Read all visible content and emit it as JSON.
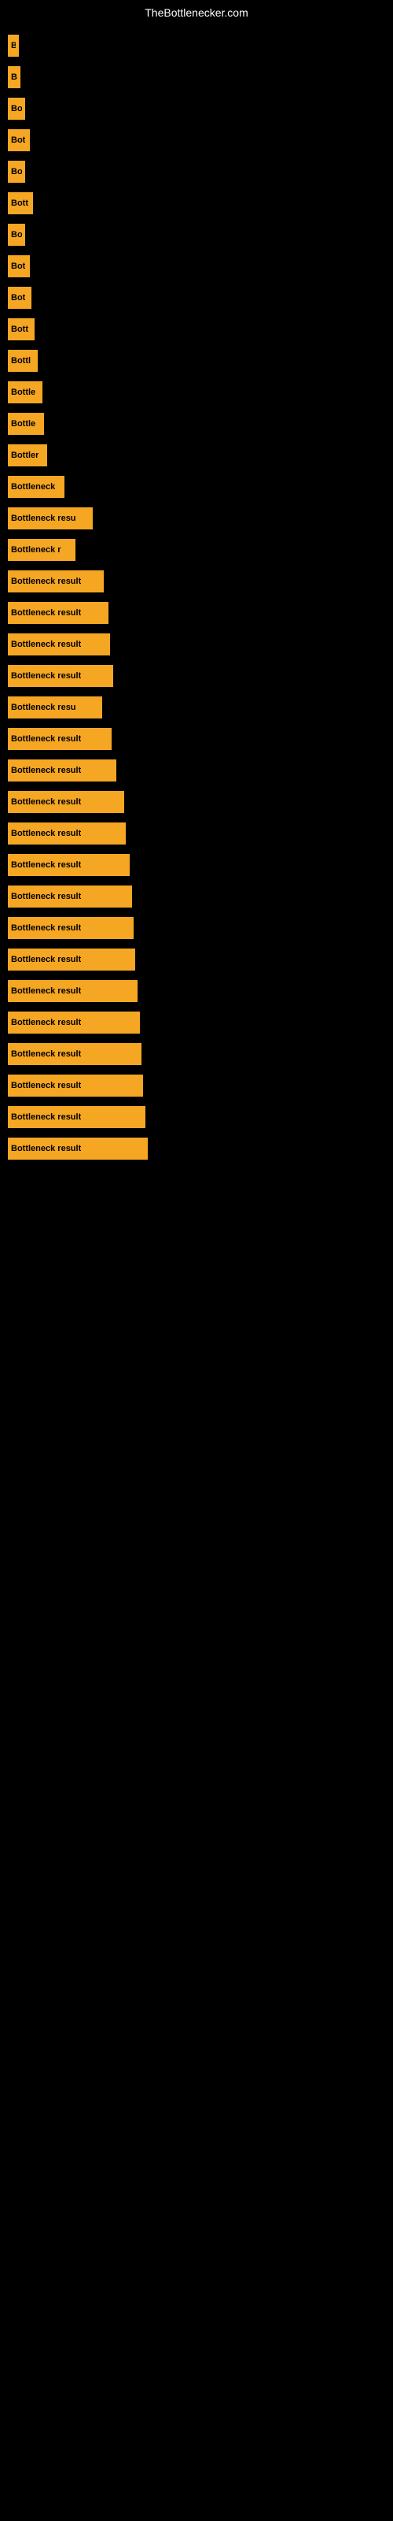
{
  "site": {
    "title": "TheBottlenecker.com"
  },
  "bars": [
    {
      "label": "B",
      "width": 14
    },
    {
      "label": "B",
      "width": 16
    },
    {
      "label": "Bo",
      "width": 22
    },
    {
      "label": "Bot",
      "width": 28
    },
    {
      "label": "Bo",
      "width": 22
    },
    {
      "label": "Bott",
      "width": 32
    },
    {
      "label": "Bo",
      "width": 22
    },
    {
      "label": "Bot",
      "width": 28
    },
    {
      "label": "Bot",
      "width": 30
    },
    {
      "label": "Bott",
      "width": 34
    },
    {
      "label": "Bottl",
      "width": 38
    },
    {
      "label": "Bottle",
      "width": 44
    },
    {
      "label": "Bottle",
      "width": 46
    },
    {
      "label": "Bottler",
      "width": 50
    },
    {
      "label": "Bottleneck",
      "width": 72
    },
    {
      "label": "Bottleneck resu",
      "width": 108
    },
    {
      "label": "Bottleneck r",
      "width": 86
    },
    {
      "label": "Bottleneck result",
      "width": 122
    },
    {
      "label": "Bottleneck result",
      "width": 128
    },
    {
      "label": "Bottleneck result",
      "width": 130
    },
    {
      "label": "Bottleneck result",
      "width": 134
    },
    {
      "label": "Bottleneck resu",
      "width": 120
    },
    {
      "label": "Bottleneck result",
      "width": 132
    },
    {
      "label": "Bottleneck result",
      "width": 138
    },
    {
      "label": "Bottleneck result",
      "width": 148
    },
    {
      "label": "Bottleneck result",
      "width": 150
    },
    {
      "label": "Bottleneck result",
      "width": 155
    },
    {
      "label": "Bottleneck result",
      "width": 158
    },
    {
      "label": "Bottleneck result",
      "width": 160
    },
    {
      "label": "Bottleneck result",
      "width": 162
    },
    {
      "label": "Bottleneck result",
      "width": 165
    },
    {
      "label": "Bottleneck result",
      "width": 168
    },
    {
      "label": "Bottleneck result",
      "width": 170
    },
    {
      "label": "Bottleneck result",
      "width": 172
    },
    {
      "label": "Bottleneck result",
      "width": 175
    },
    {
      "label": "Bottleneck result",
      "width": 178
    }
  ]
}
